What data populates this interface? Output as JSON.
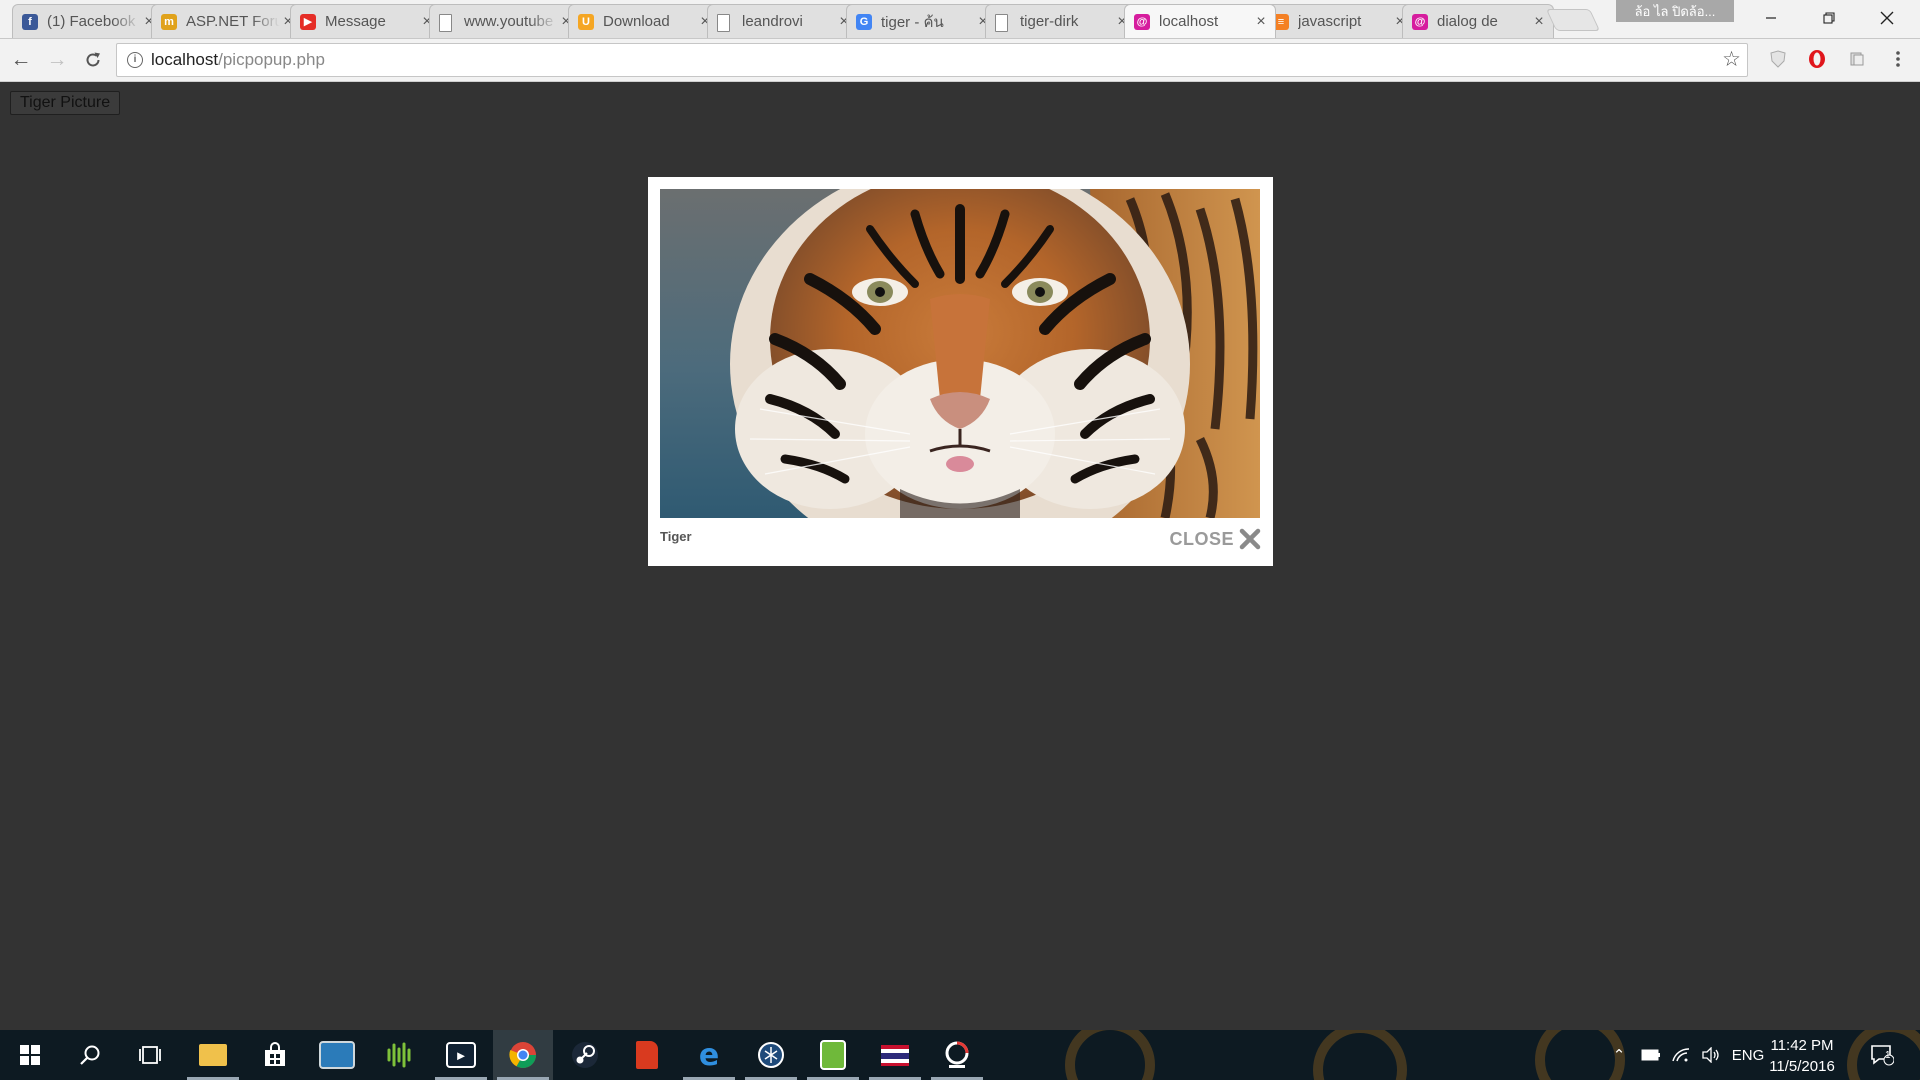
{
  "browser": {
    "tabs": [
      {
        "title": "(1) Facebook",
        "favicon": "facebook-icon",
        "color": "#3b5998",
        "glyph": "f"
      },
      {
        "title": "ASP.NET Forums",
        "favicon": "asp-net-icon",
        "color": "#e0a21b",
        "glyph": "m"
      },
      {
        "title": "Message",
        "favicon": "youtube-icon",
        "color": "#e52d27",
        "glyph": "▶"
      },
      {
        "title": "www.youtube",
        "favicon": "document-icon",
        "color": "",
        "glyph": ""
      },
      {
        "title": "Download",
        "favicon": "download-site-icon",
        "color": "#f5a623",
        "glyph": "U"
      },
      {
        "title": "leandrovi",
        "favicon": "document-icon",
        "color": "",
        "glyph": ""
      },
      {
        "title": "tiger - ค้น",
        "favicon": "google-icon",
        "color": "#4285f4",
        "glyph": "G"
      },
      {
        "title": "tiger-dirk",
        "favicon": "document-icon",
        "color": "",
        "glyph": ""
      },
      {
        "title": "localhost",
        "favicon": "localhost-icon",
        "color": "#d61d9e",
        "glyph": "@",
        "active": true
      },
      {
        "title": "javascript",
        "favicon": "stackoverflow-icon",
        "color": "#f48024",
        "glyph": "≡"
      },
      {
        "title": "dialog de",
        "favicon": "localhost-icon",
        "color": "#d61d9e",
        "glyph": "@"
      }
    ],
    "profile_label": "ล้อ ไล ปิดล้อ...",
    "url_host": "localhost",
    "url_path": "/picpopup.php"
  },
  "page": {
    "button_label": "Tiger Picture",
    "lightbox": {
      "caption": "Tiger",
      "close_label": "CLOSE"
    }
  },
  "taskbar": {
    "apps": [
      "start-icon",
      "search-icon",
      "task-view-icon",
      "file-explorer-icon",
      "store-icon",
      "remote-desktop-icon",
      "audio-app-icon",
      "film-editor-icon",
      "chrome-icon",
      "steam-icon",
      "acrobat-icon",
      "edge-icon",
      "vpn-icon",
      "file-app-icon",
      "flag-app-icon",
      "photoscape-icon"
    ],
    "language": "ENG",
    "time": "11:42 PM",
    "date": "11/5/2016",
    "notification_count": "1"
  }
}
